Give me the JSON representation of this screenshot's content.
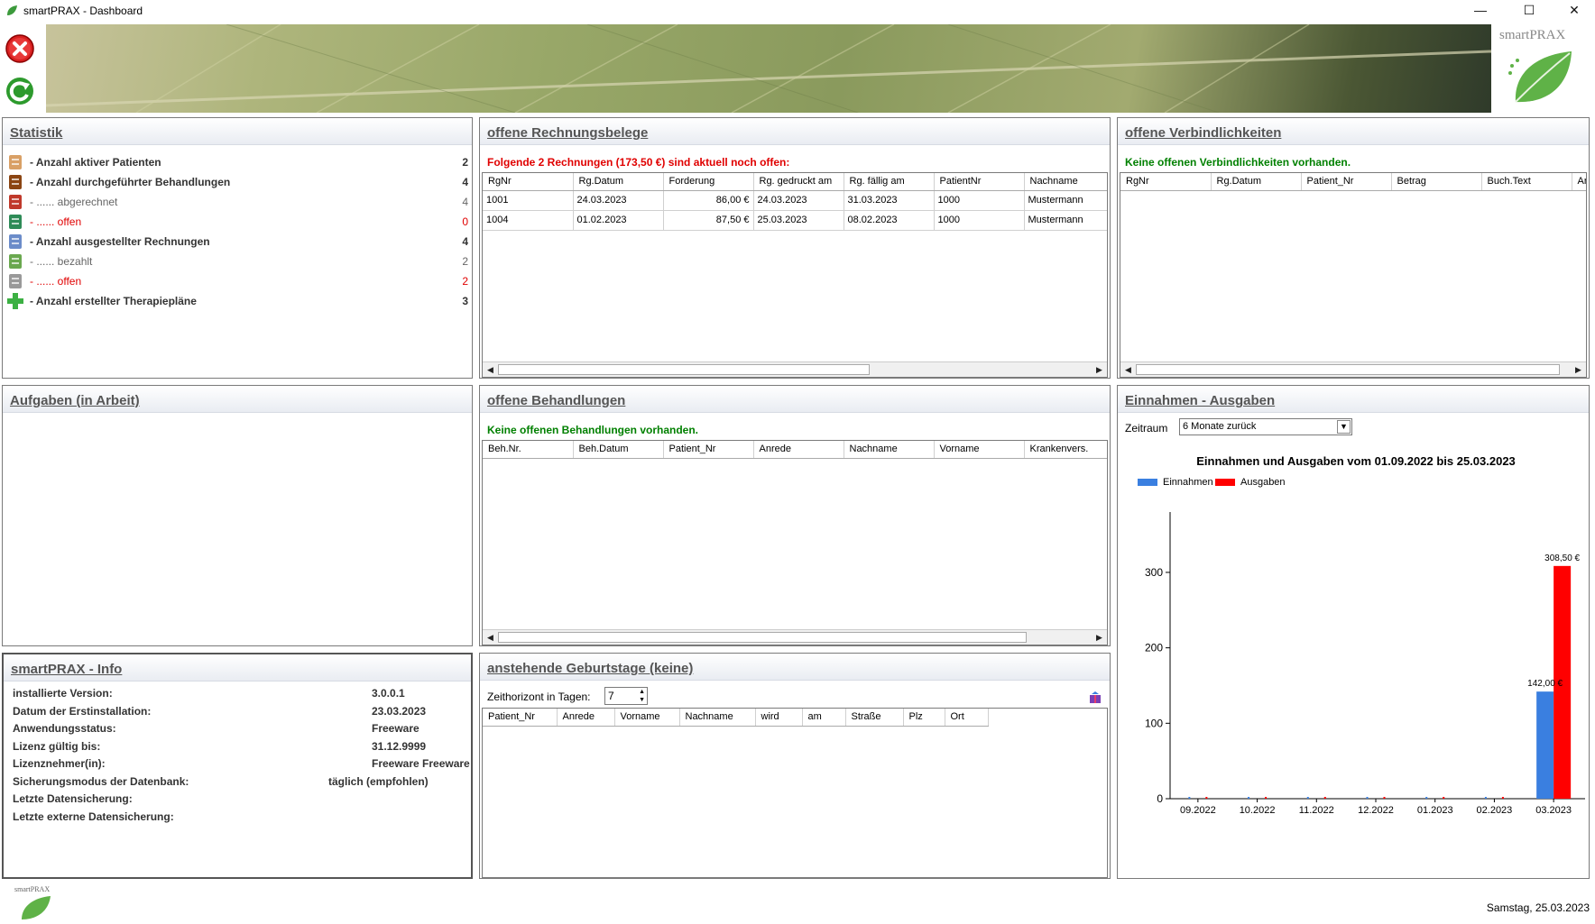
{
  "window": {
    "title": "smartPRAX - Dashboard",
    "minimize": "—",
    "maximize": "☐",
    "close": "✕"
  },
  "header": {
    "logo_text": "smartPRAX"
  },
  "statistik": {
    "title": "Statistik",
    "rows": [
      {
        "label": "- Anzahl aktiver Patienten",
        "value": "2",
        "style": "bold",
        "icon": "patients-icon"
      },
      {
        "label": "- Anzahl durchgeführter Behandlungen",
        "value": "4",
        "style": "bold",
        "icon": "book-icon"
      },
      {
        "label": "- ...... abgerechnet",
        "value": "4",
        "style": "gray",
        "icon": "calendar-icon"
      },
      {
        "label": "- ...... offen",
        "value": "0",
        "style": "red",
        "icon": "calendar-add-icon"
      },
      {
        "label": "- Anzahl ausgestellter Rechnungen",
        "value": "4",
        "style": "bold",
        "icon": "invoice-icon"
      },
      {
        "label": "- ...... bezahlt",
        "value": "2",
        "style": "gray",
        "icon": "money-icon"
      },
      {
        "label": "- ...... offen",
        "value": "2",
        "style": "red",
        "icon": "invoice-open-icon"
      },
      {
        "label": "- Anzahl erstellter Therapiepläne",
        "value": "3",
        "style": "bold",
        "icon": "plus-icon"
      }
    ]
  },
  "rechnungen": {
    "title": "offene Rechnungsbelege",
    "message": "Folgende 2 Rechnungen (173,50 €) sind aktuell noch offen:",
    "columns": [
      "RgNr",
      "Rg.Datum",
      "Forderung",
      "Rg. gedruckt am",
      "Rg. fällig am",
      "PatientNr",
      "Nachname"
    ],
    "rows": [
      [
        "1001",
        "24.03.2023",
        "86,00 €",
        "24.03.2023",
        "31.03.2023",
        "1000",
        "Mustermann"
      ],
      [
        "1004",
        "01.02.2023",
        "87,50 €",
        "25.03.2023",
        "08.02.2023",
        "1000",
        "Mustermann"
      ]
    ]
  },
  "verbindlichkeiten": {
    "title": "offene Verbindlichkeiten",
    "message": "Keine offenen Verbindlichkeiten vorhanden.",
    "columns": [
      "RgNr",
      "Rg.Datum",
      "Patient_Nr",
      "Betrag",
      "Buch.Text",
      "An"
    ]
  },
  "aufgaben": {
    "title": "Aufgaben (in Arbeit)"
  },
  "behandlungen": {
    "title": "offene Behandlungen",
    "message": "Keine offenen Behandlungen vorhanden.",
    "columns": [
      "Beh.Nr.",
      "Beh.Datum",
      "Patient_Nr",
      "Anrede",
      "Nachname",
      "Vorname",
      "Krankenvers."
    ]
  },
  "einnahmen": {
    "title": "Einnahmen - Ausgaben",
    "zeitraum_label": "Zeitraum",
    "zeitraum_value": "6 Monate zurück"
  },
  "info": {
    "title": "smartPRAX - Info",
    "rows": [
      {
        "k": "installierte Version:",
        "v": "3.0.0.1"
      },
      {
        "k": "Datum der Erstinstallation:",
        "v": "23.03.2023"
      },
      {
        "k": "Anwendungsstatus:",
        "v": "Freeware"
      },
      {
        "k": "Lizenz gültig bis:",
        "v": "31.12.9999"
      },
      {
        "k": "Lizenznehmer(in):",
        "v": "Freeware Freeware"
      },
      {
        "k": "Sicherungsmodus der Datenbank:",
        "v": "täglich (empfohlen)"
      },
      {
        "k": "Letzte Datensicherung:",
        "v": ""
      },
      {
        "k": "Letzte externe Datensicherung:",
        "v": ""
      }
    ]
  },
  "geburtstage": {
    "title": "anstehende Geburtstage (keine)",
    "horizont_label": "Zeithorizont in Tagen:",
    "horizont_value": "7",
    "columns": [
      "Patient_Nr",
      "Anrede",
      "Vorname",
      "Nachname",
      "wird",
      "am",
      "Straße",
      "Plz",
      "Ort"
    ]
  },
  "footer": {
    "logo_text": "smartPRAX",
    "date": "Samstag, 25.03.2023"
  },
  "chart_data": {
    "type": "bar",
    "title": "Einnahmen und Ausgaben vom 01.09.2022 bis 25.03.2023",
    "categories": [
      "09.2022",
      "10.2022",
      "11.2022",
      "12.2022",
      "01.2023",
      "02.2023",
      "03.2023"
    ],
    "series": [
      {
        "name": "Einnahmen",
        "color": "#3a7fe0",
        "values": [
          0,
          0,
          0,
          0,
          0,
          0,
          142.0
        ]
      },
      {
        "name": "Ausgaben",
        "color": "#ff0000",
        "values": [
          0,
          0,
          0,
          0,
          0,
          0,
          308.5
        ]
      }
    ],
    "data_labels": [
      {
        "series": "Einnahmen",
        "category": "03.2023",
        "text": "142,00 €"
      },
      {
        "series": "Ausgaben",
        "category": "03.2023",
        "text": "308,50 €"
      }
    ],
    "yticks": [
      0,
      100,
      200,
      300
    ],
    "ylim": [
      0,
      380
    ],
    "legend": "top-left",
    "grid": false
  }
}
